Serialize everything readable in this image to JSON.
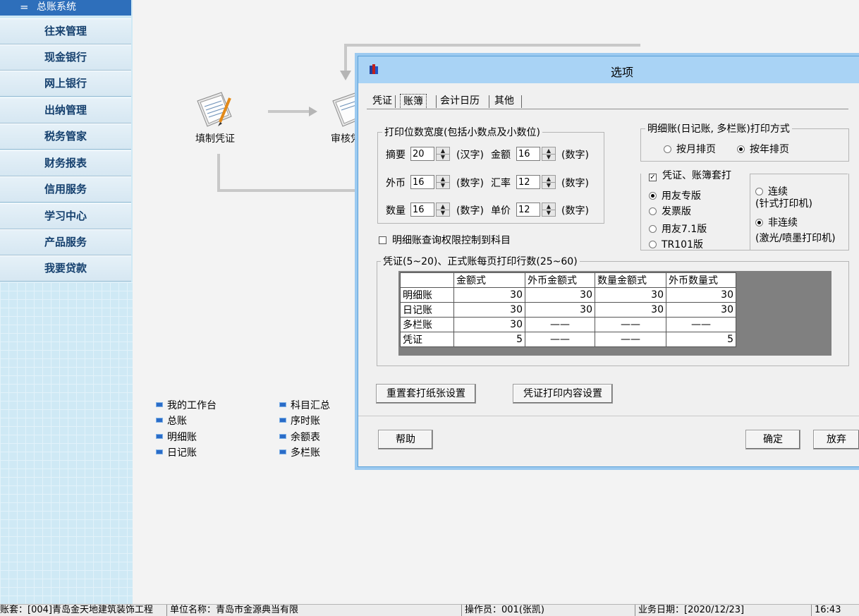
{
  "sidebar": {
    "top_item": {
      "mark": "=",
      "label": "总账系统"
    },
    "items": [
      "往来管理",
      "现金银行",
      "网上银行",
      "出纳管理",
      "税务管家",
      "财务报表",
      "信用服务",
      "学习中心",
      "产品服务",
      "我要贷款"
    ]
  },
  "flow": {
    "nodes": [
      "填制凭证",
      "审核凭"
    ]
  },
  "quick_links": {
    "col1": [
      "我的工作台",
      "总账",
      "明细账",
      "日记账"
    ],
    "col2": [
      "科目汇总",
      "序时账",
      "余额表",
      "多栏账"
    ]
  },
  "status_bar": {
    "account_set": "账套：[004]青岛金天地建筑装饰工程",
    "unit_name": "单位名称：青岛市金源典当有限",
    "operator": "操作员：001(张凯)",
    "business_date": "业务日期：[2020/12/23]",
    "time": "16:43"
  },
  "dialog": {
    "title": "选项",
    "tabs": [
      "凭证",
      "账簿",
      "会计日历",
      "其他"
    ],
    "active_tab": "账簿",
    "width_group": {
      "title": "打印位数宽度(包括小数点及小数位)",
      "rows": [
        {
          "label1": "摘要",
          "value1": "20",
          "unit1": "(汉字)",
          "label2": "金额",
          "value2": "16",
          "unit2": "(数字)"
        },
        {
          "label1": "外币",
          "value1": "16",
          "unit1": "(数字)",
          "label2": "汇率",
          "value2": "12",
          "unit2": "(数字)"
        },
        {
          "label1": "数量",
          "value1": "16",
          "unit1": "(数字)",
          "label2": "单价",
          "value2": "12",
          "unit2": "(数字)"
        }
      ]
    },
    "detail_print_group": {
      "title": "明细账(日记账, 多栏账)打印方式",
      "options": [
        "按月排页",
        "按年排页"
      ],
      "selected": "按年排页"
    },
    "set_print": {
      "label": "凭证、账簿套打",
      "checked": true,
      "versions": [
        "用友专版",
        "发票版",
        "用友7.1版",
        "TR101版"
      ],
      "selected_version": "用友专版",
      "printer_types": [
        {
          "line1": "连续",
          "line2": "(针式打印机)"
        },
        {
          "line1": "非连续",
          "line2": "(激光/喷墨打印机)"
        }
      ],
      "selected_printer": "非连续"
    },
    "query_permission": {
      "label": "明细账查询权限控制到科目",
      "checked": false
    },
    "lines_group": {
      "title": "凭证(5~20)、正式账每页打印行数(25~60)",
      "columns": [
        "金额式",
        "外币金额式",
        "数量金额式",
        "外币数量式"
      ],
      "rows": [
        {
          "name": "明细账",
          "cells": [
            "30",
            "30",
            "30",
            "30"
          ]
        },
        {
          "name": "日记账",
          "cells": [
            "30",
            "30",
            "30",
            "30"
          ]
        },
        {
          "name": "多栏账",
          "cells": [
            "30",
            "——",
            "——",
            "——"
          ]
        },
        {
          "name": "凭证",
          "cells": [
            "5",
            "——",
            "——",
            "5"
          ]
        }
      ]
    },
    "buttons": {
      "reset_paper": "重置套打纸张设置",
      "voucher_content": "凭证打印内容设置",
      "help": "帮助",
      "ok": "确定",
      "cancel": "放弃"
    }
  }
}
